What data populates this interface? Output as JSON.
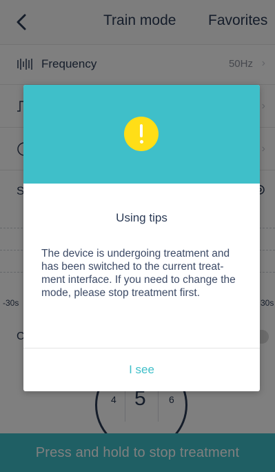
{
  "header": {
    "title": "Train mode",
    "favorites_label": "Favorites"
  },
  "rows": [
    {
      "icon": "frequency-icon",
      "label": "Frequency",
      "value": "50Hz"
    },
    {
      "icon": "pulse-width-icon",
      "label": "",
      "value": ""
    },
    {
      "icon": "timer-icon",
      "label": "",
      "value": ""
    }
  ],
  "background": {
    "row4_letter": "S",
    "chart_left_label": "-30s",
    "chart_right_label": "30s",
    "row5_letter": "C",
    "dial": {
      "left": "4",
      "center": "5",
      "right": "6"
    }
  },
  "dialog": {
    "title": "Using tips",
    "message": "The device is undergoing treatment and has been switched to the current treat-ment interface. If you need to change the mode, please stop treatment first.",
    "button_label": "I see"
  },
  "bottom_bar": {
    "label": "Press and hold to stop treatment"
  },
  "colors": {
    "accent": "#3fbfc9",
    "warning": "#ffde17",
    "text": "#2b3a55"
  }
}
